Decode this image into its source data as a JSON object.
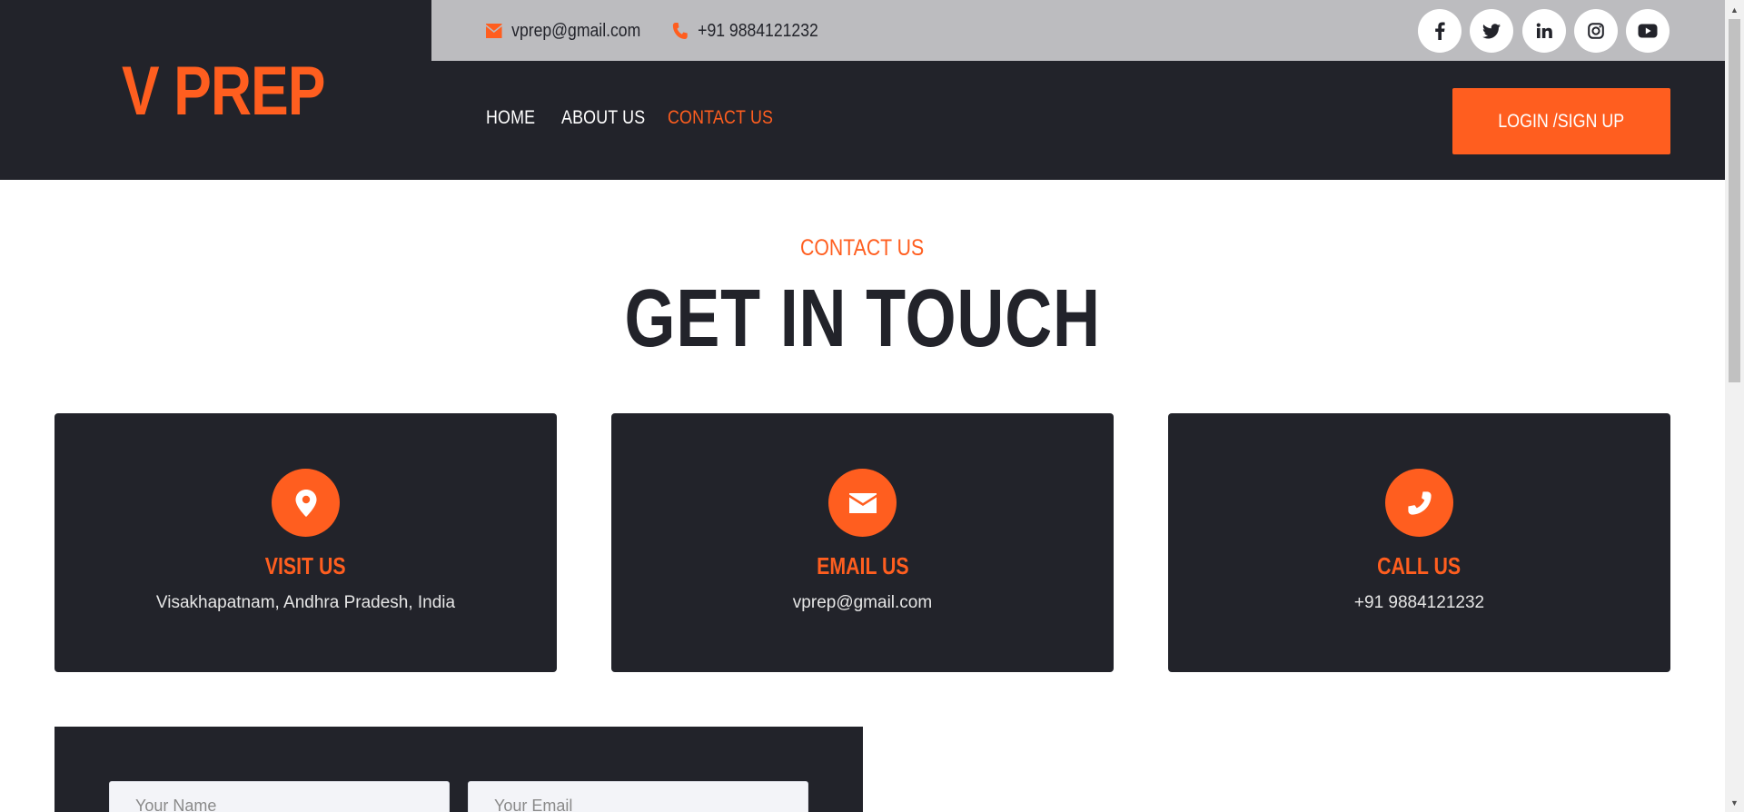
{
  "brand": {
    "logo_text": "V PREP"
  },
  "topbar": {
    "email": "vprep@gmail.com",
    "phone": "+91 9884121232",
    "social": [
      "facebook-icon",
      "twitter-icon",
      "linkedin-icon",
      "instagram-icon",
      "youtube-icon"
    ]
  },
  "nav": {
    "items": [
      {
        "label": "HOME",
        "active": false
      },
      {
        "label": "ABOUT US",
        "active": false
      },
      {
        "label": "CONTACT US",
        "active": true
      }
    ],
    "login_label": "LOGIN /SIGN UP"
  },
  "section": {
    "kicker": "CONTACT US",
    "title": "GET IN TOUCH"
  },
  "cards": [
    {
      "icon": "map-pin-icon",
      "title": "VISIT US",
      "text": "Visakhapatnam, Andhra Pradesh, India"
    },
    {
      "icon": "envelope-icon",
      "title": "EMAIL US",
      "text": "vprep@gmail.com"
    },
    {
      "icon": "phone-icon",
      "title": "CALL US",
      "text": "+91 9884121232"
    }
  ],
  "form": {
    "name_placeholder": "Your Name",
    "email_placeholder": "Your Email"
  },
  "colors": {
    "accent": "#ff5e1f",
    "dark": "#22232a",
    "topbar": "#bcbcbf"
  }
}
